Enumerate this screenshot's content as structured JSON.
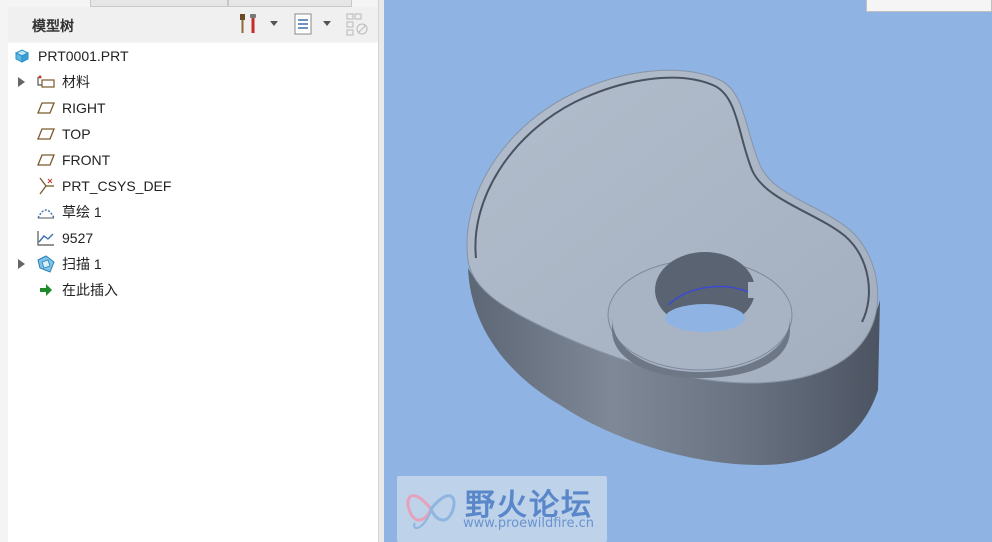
{
  "panel": {
    "title": "模型树"
  },
  "tree": {
    "items": [
      {
        "label": "PRT0001.PRT",
        "icon": "part-icon",
        "expandable": false
      },
      {
        "label": "材料",
        "icon": "material-icon",
        "expandable": true
      },
      {
        "label": "RIGHT",
        "icon": "datum-plane-icon",
        "expandable": false
      },
      {
        "label": "TOP",
        "icon": "datum-plane-icon",
        "expandable": false
      },
      {
        "label": "FRONT",
        "icon": "datum-plane-icon",
        "expandable": false
      },
      {
        "label": "PRT_CSYS_DEF",
        "icon": "coordinate-system-icon",
        "expandable": false
      },
      {
        "label": "草绘 1",
        "icon": "sketch-icon",
        "expandable": false
      },
      {
        "label": "9527",
        "icon": "graph-icon",
        "expandable": false
      },
      {
        "label": "扫描 1",
        "icon": "sweep-icon",
        "expandable": true
      },
      {
        "label": "在此插入",
        "icon": "insert-here-arrow-icon",
        "expandable": false
      }
    ]
  },
  "watermark": {
    "title": "野火论坛",
    "url": "www.proewildfire.cn"
  },
  "colors": {
    "viewport_bg": "#8fb3e3",
    "part_top": "#aab7c8",
    "part_side": "#6e7886"
  }
}
